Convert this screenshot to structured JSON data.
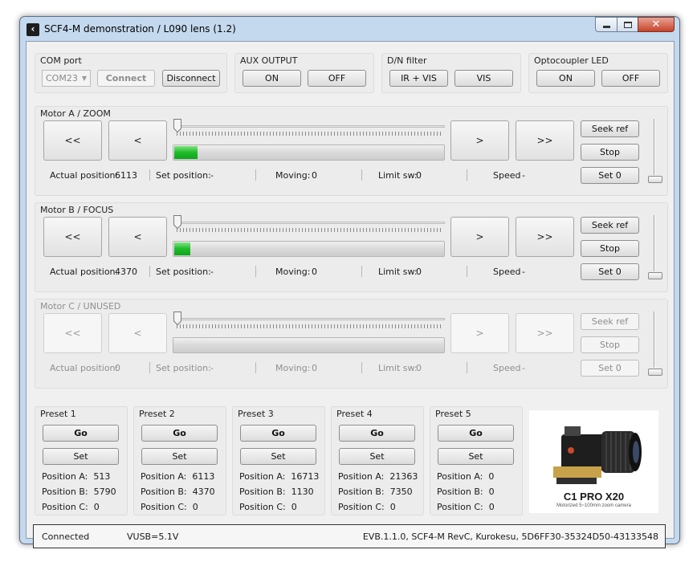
{
  "window": {
    "title": "SCF4-M demonstration / L090 lens (1.2)"
  },
  "com": {
    "title": "COM port",
    "port_value": "COM23",
    "connect_label": "Connect",
    "disconnect_label": "Disconnect"
  },
  "aux": {
    "title": "AUX OUTPUT",
    "on_label": "ON",
    "off_label": "OFF"
  },
  "dn": {
    "title": "D/N filter",
    "irvis_label": "IR + VIS",
    "vis_label": "VIS"
  },
  "opto": {
    "title": "Optocoupler LED",
    "on_label": "ON",
    "off_label": "OFF"
  },
  "motors": [
    {
      "title": "Motor A / ZOOM",
      "enabled": true,
      "progress_fraction": 0.085,
      "btn_fast_left": "<<",
      "btn_left": "<",
      "btn_right": ">",
      "btn_fast_right": ">>",
      "seek_ref": "Seek ref",
      "stop": "Stop",
      "set0": "Set 0",
      "actual_label": "Actual position:",
      "actual_value": "6113",
      "set_label": "Set position:",
      "set_value": "-",
      "moving_label": "Moving:",
      "moving_value": "0",
      "limit_label": "Limit sw:",
      "limit_value": "0",
      "speed_label": "Speed",
      "speed_value": "-"
    },
    {
      "title": "Motor B / FOCUS",
      "enabled": true,
      "progress_fraction": 0.06,
      "btn_fast_left": "<<",
      "btn_left": "<",
      "btn_right": ">",
      "btn_fast_right": ">>",
      "seek_ref": "Seek ref",
      "stop": "Stop",
      "set0": "Set 0",
      "actual_label": "Actual position:",
      "actual_value": "4370",
      "set_label": "Set position:",
      "set_value": "-",
      "moving_label": "Moving:",
      "moving_value": "0",
      "limit_label": "Limit sw:",
      "limit_value": "0",
      "speed_label": "Speed",
      "speed_value": "-"
    },
    {
      "title": "Motor C / UNUSED",
      "enabled": false,
      "progress_fraction": 0,
      "btn_fast_left": "<<",
      "btn_left": "<",
      "btn_right": ">",
      "btn_fast_right": ">>",
      "seek_ref": "Seek ref",
      "stop": "Stop",
      "set0": "Set 0",
      "actual_label": "Actual position:",
      "actual_value": "0",
      "set_label": "Set position:",
      "set_value": "-",
      "moving_label": "Moving:",
      "moving_value": "0",
      "limit_label": "Limit sw:",
      "limit_value": "0",
      "speed_label": "Speed",
      "speed_value": "-"
    }
  ],
  "presets": [
    {
      "title": "Preset 1",
      "go": "Go",
      "set": "Set",
      "a_label": "Position A:",
      "a": "513",
      "b_label": "Position B:",
      "b": "5790",
      "c_label": "Position C:",
      "c": "0"
    },
    {
      "title": "Preset 2",
      "go": "Go",
      "set": "Set",
      "a_label": "Position A:",
      "a": "6113",
      "b_label": "Position B:",
      "b": "4370",
      "c_label": "Position C:",
      "c": "0"
    },
    {
      "title": "Preset 3",
      "go": "Go",
      "set": "Set",
      "a_label": "Position A:",
      "a": "16713",
      "b_label": "Position B:",
      "b": "1130",
      "c_label": "Position C:",
      "c": "0"
    },
    {
      "title": "Preset 4",
      "go": "Go",
      "set": "Set",
      "a_label": "Position A:",
      "a": "21363",
      "b_label": "Position B:",
      "b": "7350",
      "c_label": "Position C:",
      "c": "0"
    },
    {
      "title": "Preset 5",
      "go": "Go",
      "set": "Set",
      "a_label": "Position A:",
      "a": "0",
      "b_label": "Position B:",
      "b": "0",
      "c_label": "Position C:",
      "c": "0"
    }
  ],
  "product": {
    "name": "C1 PRO X20",
    "tagline": "Motorized 5~100mm zoom camera"
  },
  "status": {
    "connection": "Connected",
    "vusb": "VUSB=5.1V",
    "info": "EVB.1.1.0, SCF4-M RevC, Kurokesu, 5D6FF30-35324D50-43133548"
  },
  "colors": {
    "progress_green": "#1fbb2a",
    "window_frame": "#c4d9ee",
    "close_button": "#c7432a"
  }
}
